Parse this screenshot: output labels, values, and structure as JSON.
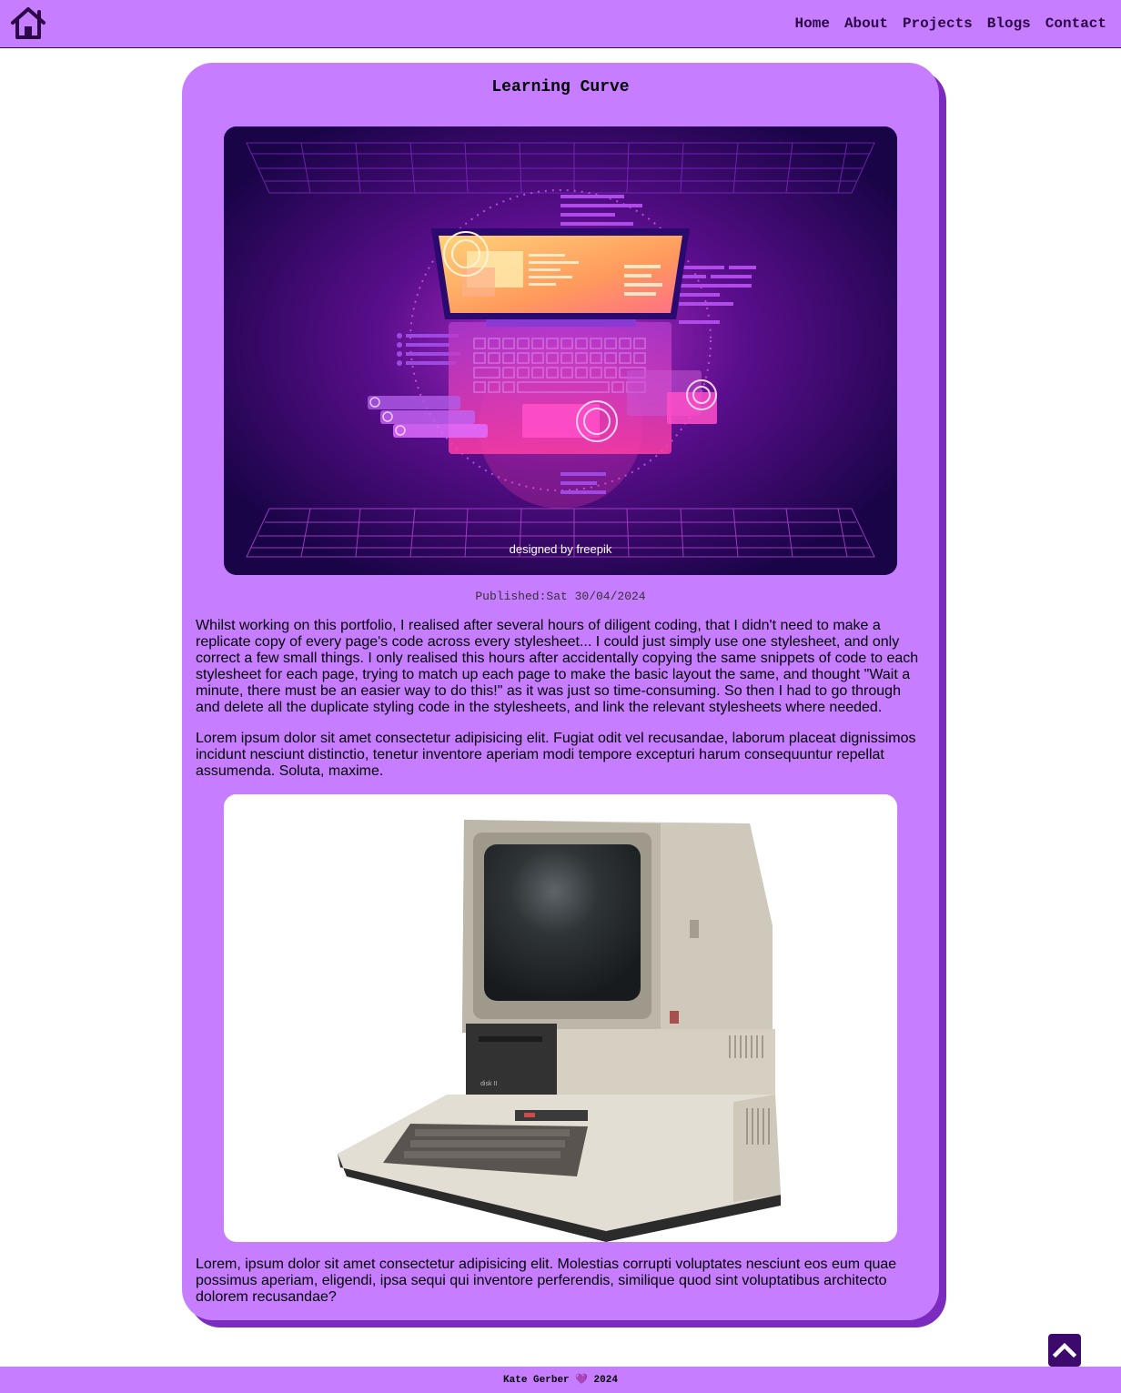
{
  "nav": {
    "home_icon": "home-icon",
    "links": [
      "Home",
      "About",
      "Projects",
      "Blogs",
      "Contact"
    ]
  },
  "post": {
    "title": "Learning Curve",
    "hero_credit": "designed by freepik",
    "hero_icon": "laptop-illustration",
    "published": "Published:Sat 30/04/2024",
    "paragraphs": [
      "Whilst working on this portfolio, I realised after several hours of diligent coding, that I didn't need to make a replicate copy of every page's code across every stylesheet... I could just simply use one stylesheet, and only correct a few small things. I only realised this hours after accidentally copying the same snippets of code to each stylesheet for each page, trying to match up each page to make the basic layout the same, and thought \"Wait a minute, there must be an easier way to do this!\" as it was just so time-consuming. So then I had to go through and delete all the duplicate styling code in the stylesheets, and link the relevant stylesheets where needed.",
      "Lorem ipsum dolor sit amet consectetur adipisicing elit. Fugiat odit vel recusandae, laborum placeat dignissimos incidunt nesciunt distinctio, tenetur inventore aperiam modi tempore excepturi harum consequuntur repellat assumenda. Soluta, maxime.",
      "Lorem, ipsum dolor sit amet consectetur adipisicing elit. Molestias corrupti voluptates nesciunt eos eum quae possimus aperiam, eligendi, ipsa sequi qui inventore perferendis, similique quod sint voluptatibus architecto dolorem recusandae?"
    ],
    "photo_icon": "vintage-computer-photo"
  },
  "back_to_top_icon": "chevron-up-icon",
  "footer": {
    "text": "Kate Gerber 💜 2024"
  },
  "colors": {
    "accent": "#c77dff",
    "card_shadow": "#7b2cbf",
    "dark": "#3c096c"
  }
}
